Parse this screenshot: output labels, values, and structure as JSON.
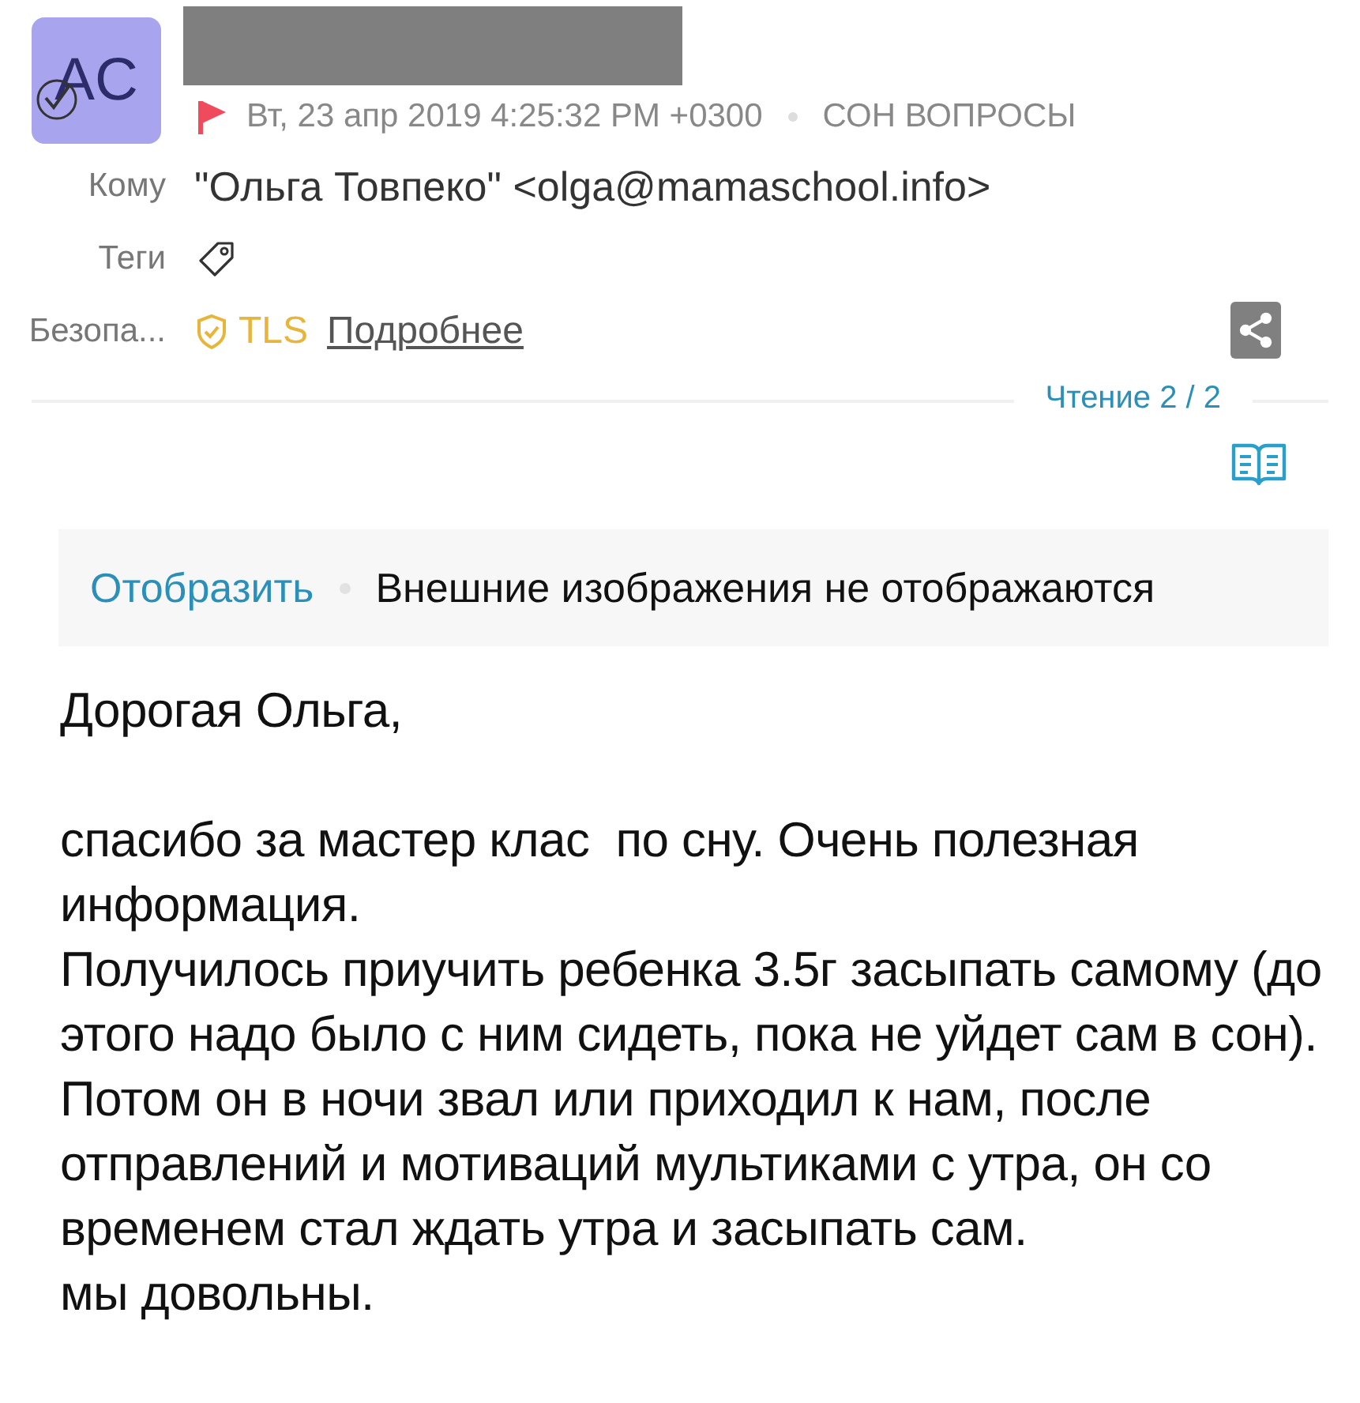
{
  "sender": {
    "avatar_initials": "AC",
    "selected": true
  },
  "meta": {
    "flagged": true,
    "date": "Вт, 23 апр 2019 4:25:32 PM +0300",
    "folder": "СОН ВОПРОСЫ"
  },
  "fields": [
    {
      "kind": "text",
      "label": "Кому",
      "value": "\"Ольга Товпеко\" <olga@mamaschool.info>"
    },
    {
      "kind": "tags",
      "label": "Теги"
    },
    {
      "kind": "security",
      "label": "Безопа...",
      "badge": "TLS",
      "link": "Подробнее"
    }
  ],
  "reading": "Чтение 2 / 2",
  "images_notice": {
    "action": "Отобразить",
    "message": "Внешние изображения не отображаются"
  },
  "body": [
    {
      "kind": "greeting",
      "text": "Дорогая Ольга,"
    },
    {
      "kind": "para",
      "text": "спасибо за мастер клас  по сну. Очень полезная информация."
    },
    {
      "kind": "para",
      "text": "Получилось приучить ребенка 3.5г засыпать самому (до этого надо было с ним сидеть, пока не уйдет сам в сон). Потом он в ночи звал или приходил к нам, после отправлений и мотиваций мультиками с утра, он со временем стал ждать утра и засыпать сам."
    },
    {
      "kind": "para",
      "text": "мы довольны."
    }
  ]
}
